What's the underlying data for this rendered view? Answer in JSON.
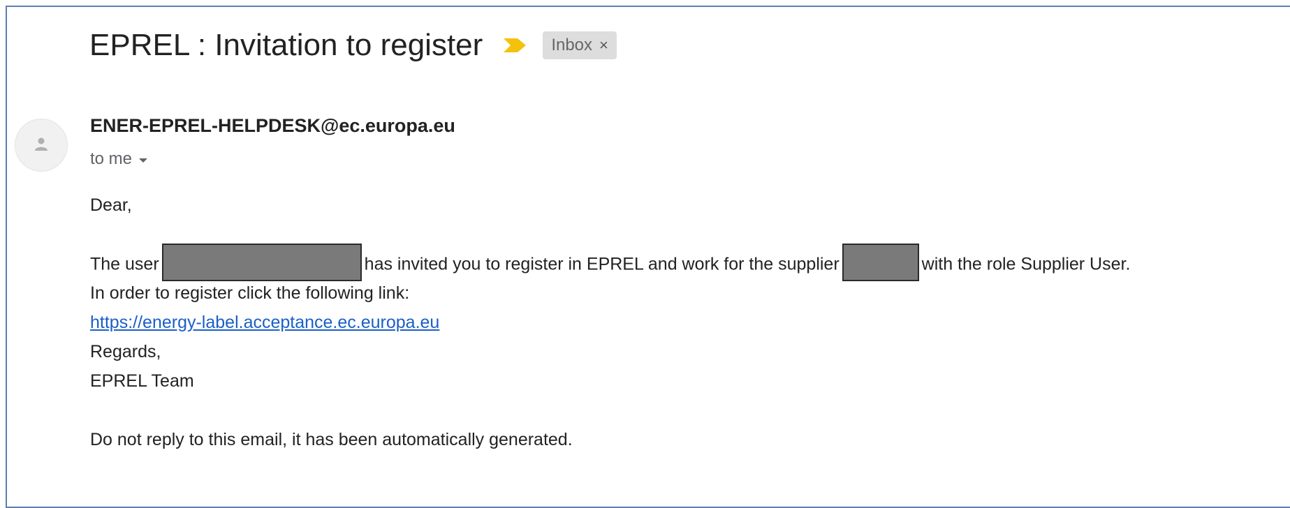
{
  "email": {
    "subject": "EPREL : Invitation to register",
    "label": "Inbox",
    "label_close": "×",
    "sender": "ENER-EPREL-HELPDESK@ec.europa.eu",
    "recipient": "to me",
    "greeting": "Dear,",
    "invite_prefix": "The user",
    "invite_middle": "has invited you to register in EPREL and work for the supplier",
    "invite_suffix": "with the role Supplier User.",
    "instruction": "In order to register click the following link:",
    "link": "https://energy-label.acceptance.ec.europa.eu",
    "regards": "Regards,",
    "signature": "EPREL Team",
    "footer_note": "Do not reply to this email, it has been automatically generated."
  },
  "colors": {
    "frame_border": "#5b7fb0",
    "important_marker": "#f4c20d",
    "link": "#1a5fc8",
    "label_chip_bg": "#dddddd",
    "redaction": "#7a7a7a"
  },
  "icons": {
    "important": "important-marker-icon",
    "avatar": "person-avatar-icon",
    "recipient_details": "caret-down-icon"
  }
}
